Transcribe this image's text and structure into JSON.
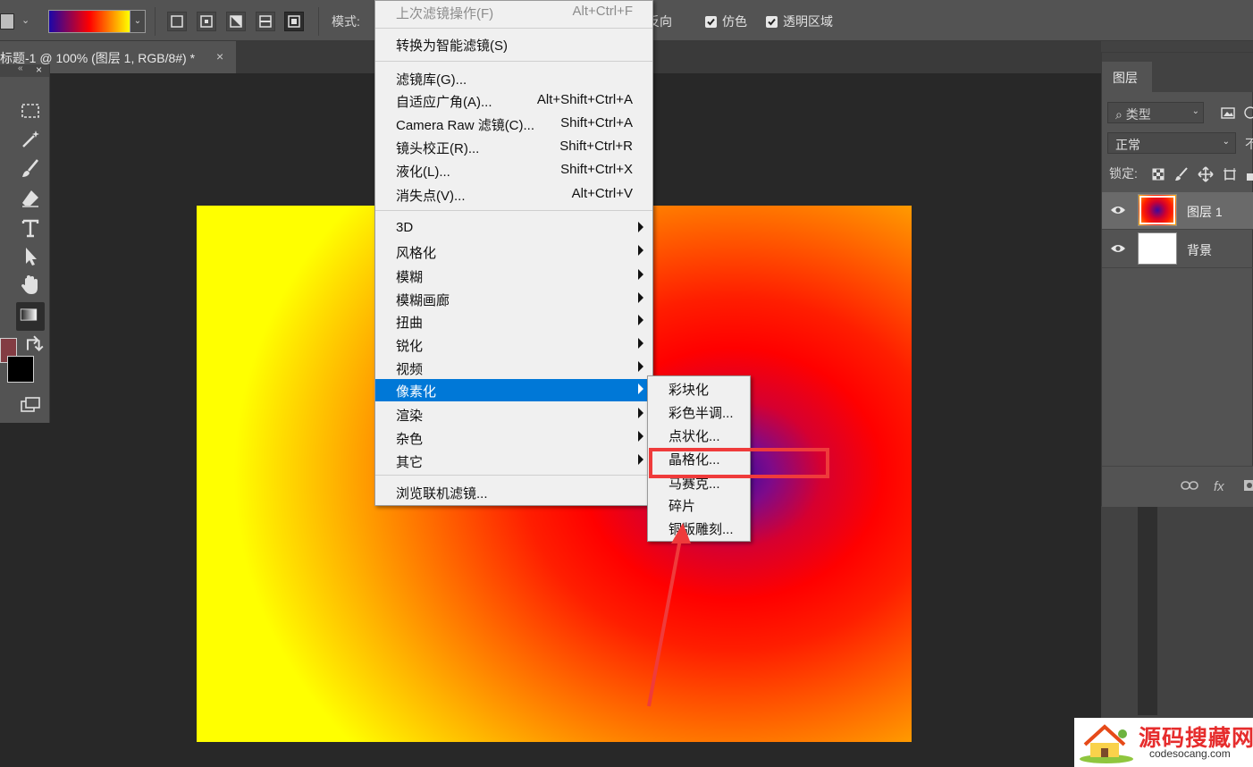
{
  "options_bar": {
    "mode_label": "模式:",
    "checks": [
      {
        "label": "反向",
        "checked": true
      },
      {
        "label": "仿色",
        "checked": true
      },
      {
        "label": "透明区域",
        "checked": true
      }
    ],
    "gradient_colors": [
      "#1a06a8",
      "#ff0000",
      "#ffff00"
    ]
  },
  "document": {
    "tab_title": "标题-1 @ 100% (图层 1, RGB/8#) *",
    "close_symbol": "×"
  },
  "toolbar": {
    "collapse_symbol": "«",
    "close_symbol": "×",
    "foreground_color": "#833c43",
    "background_color": "#000000"
  },
  "filter_menu": {
    "items": [
      {
        "label": "上次滤镜操作(F)",
        "shortcut": "Alt+Ctrl+F",
        "disabled": true
      },
      {
        "label": "转换为智能滤镜(S)",
        "shortcut": ""
      },
      {
        "label": "滤镜库(G)...",
        "shortcut": ""
      },
      {
        "label": "自适应广角(A)...",
        "shortcut": "Alt+Shift+Ctrl+A"
      },
      {
        "label": "Camera Raw 滤镜(C)...",
        "shortcut": "Shift+Ctrl+A"
      },
      {
        "label": "镜头校正(R)...",
        "shortcut": "Shift+Ctrl+R"
      },
      {
        "label": "液化(L)...",
        "shortcut": "Shift+Ctrl+X"
      },
      {
        "label": "消失点(V)...",
        "shortcut": "Alt+Ctrl+V"
      },
      {
        "label": "3D",
        "submenu": true
      },
      {
        "label": "风格化",
        "submenu": true
      },
      {
        "label": "模糊",
        "submenu": true
      },
      {
        "label": "模糊画廊",
        "submenu": true
      },
      {
        "label": "扭曲",
        "submenu": true
      },
      {
        "label": "锐化",
        "submenu": true
      },
      {
        "label": "视频",
        "submenu": true
      },
      {
        "label": "像素化",
        "submenu": true,
        "highlighted": true
      },
      {
        "label": "渲染",
        "submenu": true
      },
      {
        "label": "杂色",
        "submenu": true
      },
      {
        "label": "其它",
        "submenu": true
      },
      {
        "label": "浏览联机滤镜...",
        "shortcut": ""
      }
    ]
  },
  "pixelate_submenu": {
    "items": [
      "彩块化",
      "彩色半调...",
      "点状化...",
      "晶格化...",
      "马赛克...",
      "碎片",
      "铜版雕刻..."
    ],
    "annotated_item": "晶格化..."
  },
  "layers_panel": {
    "tab_label": "图层",
    "filter_label": "类型",
    "blend_mode": "正常",
    "opacity_label_partial": "不",
    "lock_label": "锁定:",
    "layers": [
      {
        "name": "图层 1",
        "selected": true,
        "thumb": "gradient"
      },
      {
        "name": "背景",
        "selected": false,
        "thumb": "white"
      }
    ],
    "footer_fx": "fx"
  },
  "watermark": {
    "title": "源码搜藏网",
    "url": "codesocang.com"
  },
  "colors": {
    "highlight": "#0078d7",
    "annotation_red": "#ef3b3b"
  }
}
